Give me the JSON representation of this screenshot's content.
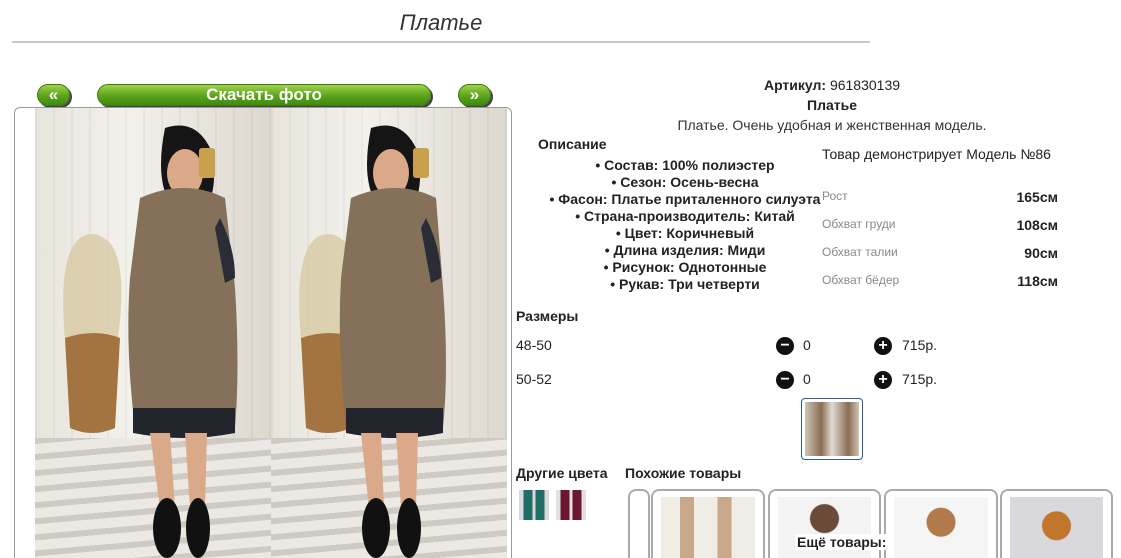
{
  "page": {
    "title": "Платье"
  },
  "gallery": {
    "prev_label": "«",
    "download_label": "Скачать фото",
    "next_label": "»"
  },
  "product": {
    "article_label": "Артикул:",
    "article_value": "961830139",
    "name": "Платье",
    "description": "Платье. Очень удобная и женственная модель."
  },
  "specs": {
    "heading": "Описание",
    "items": [
      "• Состав: 100% полиэстер",
      "• Сезон: Осень-весна",
      "• Фасон: Платье приталенного силуэта",
      "• Страна-производитель: Китай",
      "• Цвет: Коричневый",
      "• Длина изделия: Миди",
      "• Рисунок: Однотонные",
      "• Рукав: Три четверти"
    ]
  },
  "model": {
    "note": "Товар демонстрирует Модель №86",
    "measurements": [
      {
        "key": "Рост",
        "value": "165см"
      },
      {
        "key": "Обхват груди",
        "value": "108см"
      },
      {
        "key": "Обхват талии",
        "value": "90см"
      },
      {
        "key": "Обхват бёдер",
        "value": "118см"
      }
    ]
  },
  "sizes": {
    "heading": "Размеры",
    "rows": [
      {
        "size": "48-50",
        "qty": "0",
        "price": "715р."
      },
      {
        "size": "50-52",
        "qty": "0",
        "price": "715р."
      }
    ]
  },
  "related": {
    "other_colors_heading": "Другие цвета",
    "similar_heading": "Похожие товары",
    "more_label": "Ещё товары:",
    "swatch_colors": [
      "#1f6d64",
      "#6b1732"
    ]
  },
  "icons": {
    "minus": "minus-circle-icon",
    "plus": "plus-circle-icon"
  }
}
